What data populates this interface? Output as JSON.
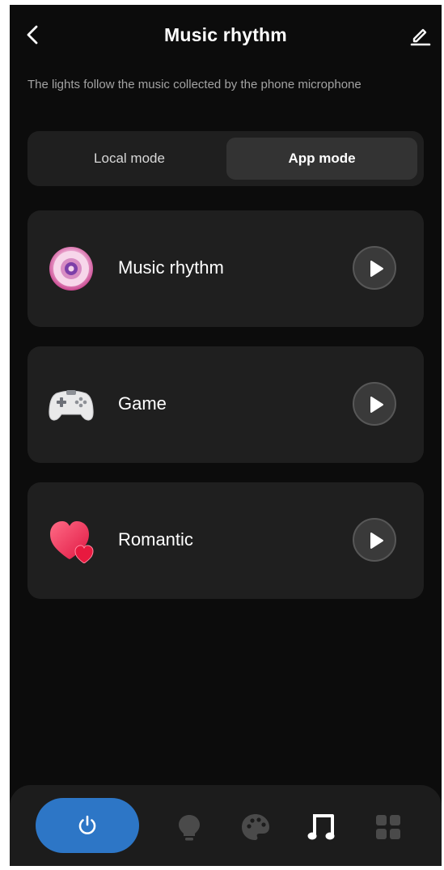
{
  "header": {
    "title": "Music rhythm"
  },
  "description": "The lights follow the music collected by the phone microphone",
  "mode_toggle": {
    "local_label": "Local mode",
    "app_label": "App mode",
    "selected": "App mode"
  },
  "scenes": [
    {
      "label": "Music rhythm",
      "icon": "vinyl-disc-icon"
    },
    {
      "label": "Game",
      "icon": "gamepad-icon"
    },
    {
      "label": "Romantic",
      "icon": "hearts-icon"
    }
  ],
  "bottom_nav": {
    "items": [
      "power-icon",
      "bulb-icon",
      "palette-icon",
      "music-note-icon",
      "grid-icon"
    ],
    "active": "music-note-icon"
  },
  "colors": {
    "background": "#0c0c0c",
    "card": "#1f1f1f",
    "accent_blue": "#2d76c6",
    "text_secondary": "#a3a3a3"
  }
}
